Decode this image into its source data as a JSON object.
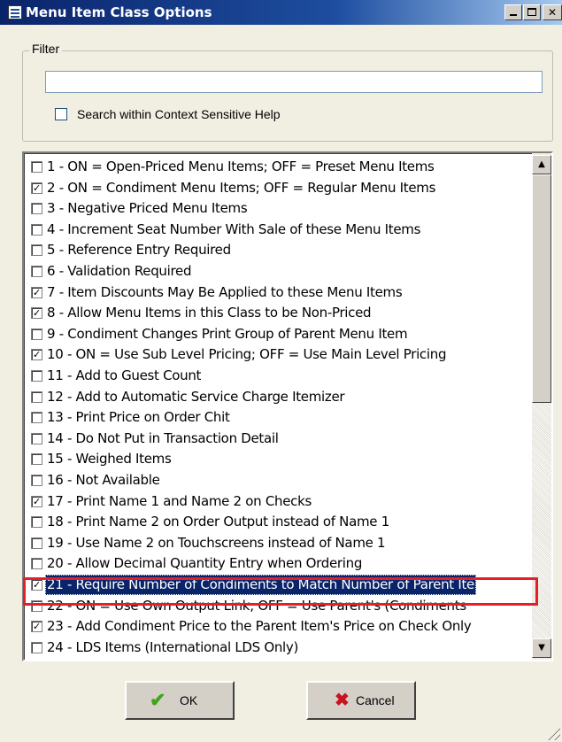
{
  "window": {
    "title": "Menu Item Class Options"
  },
  "filter": {
    "legend": "Filter",
    "input_value": "",
    "help_checkbox_label": "Search within Context Sensitive Help",
    "help_checked": false
  },
  "options": [
    {
      "label": "1 - ON = Open-Priced Menu Items; OFF = Preset Menu Items",
      "checked": false
    },
    {
      "label": "2 - ON = Condiment Menu Items; OFF = Regular Menu Items",
      "checked": true
    },
    {
      "label": "3 - Negative Priced Menu Items",
      "checked": false
    },
    {
      "label": "4 - Increment Seat Number With Sale of these Menu Items",
      "checked": false
    },
    {
      "label": "5 - Reference Entry Required",
      "checked": false
    },
    {
      "label": "6 - Validation Required",
      "checked": false
    },
    {
      "label": "7 - Item Discounts May Be Applied to these Menu Items",
      "checked": true
    },
    {
      "label": "8 - Allow Menu Items in this Class to be Non-Priced",
      "checked": true
    },
    {
      "label": "9 - Condiment Changes Print Group of Parent Menu Item",
      "checked": false
    },
    {
      "label": "10 - ON = Use Sub Level Pricing; OFF = Use Main Level Pricing",
      "checked": true
    },
    {
      "label": "11 - Add to Guest Count",
      "checked": false
    },
    {
      "label": "12 - Add to Automatic Service Charge Itemizer",
      "checked": false
    },
    {
      "label": "13 - Print Price on Order Chit",
      "checked": false
    },
    {
      "label": "14 - Do Not Put in Transaction Detail",
      "checked": false
    },
    {
      "label": "15 - Weighed Items",
      "checked": false
    },
    {
      "label": "16 - Not Available",
      "checked": false
    },
    {
      "label": "17 - Print Name 1 and Name 2 on Checks",
      "checked": true
    },
    {
      "label": "18 - Print Name 2 on Order Output instead of Name 1",
      "checked": false
    },
    {
      "label": "19 - Use Name 2 on Touchscreens instead of Name 1",
      "checked": false
    },
    {
      "label": "20 - Allow Decimal Quantity Entry when Ordering",
      "checked": false
    },
    {
      "label": "21 - Require Number of Condiments to Match Number of Parent Ite",
      "checked": true,
      "selected": true
    },
    {
      "label": "22 - ON = Use Own Output Link; OFF = Use Parent's (Condiments",
      "checked": false
    },
    {
      "label": "23 - Add Condiment Price to the Parent Item's Price on Check Only",
      "checked": true
    },
    {
      "label": "24 - LDS Items (International LDS Only)",
      "checked": false
    }
  ],
  "buttons": {
    "ok": "OK",
    "cancel": "Cancel"
  },
  "colors": {
    "highlight": "#e3202a",
    "selection": "#0a246a",
    "ok_icon": "#3ea51d",
    "cancel_icon": "#c8141e"
  }
}
